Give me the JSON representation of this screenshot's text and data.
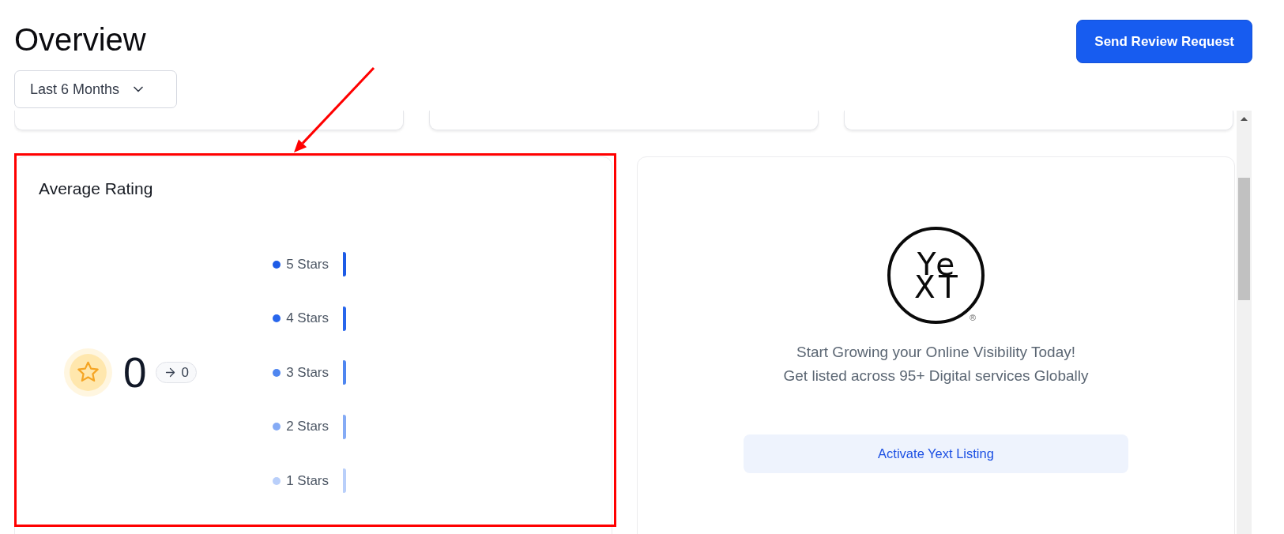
{
  "header": {
    "title": "Overview",
    "action_button": "Send Review Request",
    "period_dropdown": {
      "value": "Last 6 Months"
    }
  },
  "average_rating": {
    "title": "Average Rating",
    "score": "0",
    "change": "0",
    "rows": [
      {
        "label": "5 Stars",
        "color": "#1d5be6"
      },
      {
        "label": "4 Stars",
        "color": "#2866ec"
      },
      {
        "label": "3 Stars",
        "color": "#4f86f0"
      },
      {
        "label": "2 Stars",
        "color": "#85abf5"
      },
      {
        "label": "1 Stars",
        "color": "#b9cffa"
      }
    ]
  },
  "yext_card": {
    "logo_lines": [
      "Ye",
      "XT"
    ],
    "logo_mark": "®",
    "lines": [
      "Start Growing your Online Visibility Today!",
      "Get listed across 95+ Digital services Globally"
    ],
    "button": "Activate Yext Listing"
  }
}
